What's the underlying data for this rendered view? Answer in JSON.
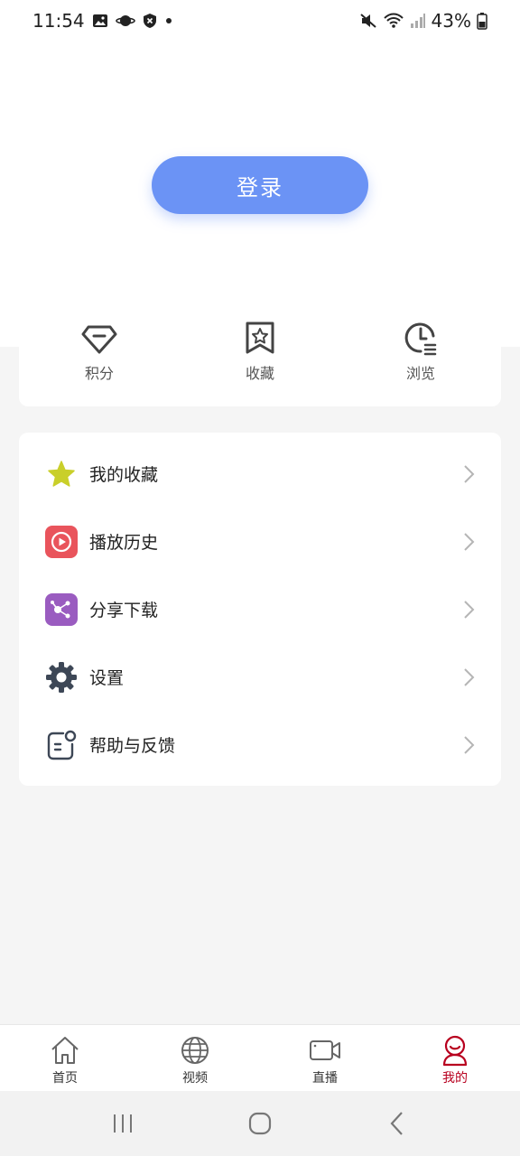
{
  "status_bar": {
    "time": "11:54",
    "battery": "43%"
  },
  "login": {
    "label": "登录"
  },
  "quick_actions": [
    {
      "label": "积分",
      "icon": "diamond-icon"
    },
    {
      "label": "收藏",
      "icon": "bookmark-star-icon"
    },
    {
      "label": "浏览",
      "icon": "history-clock-icon"
    }
  ],
  "menu": [
    {
      "label": "我的收藏",
      "icon": "star-icon"
    },
    {
      "label": "播放历史",
      "icon": "play-history-icon"
    },
    {
      "label": "分享下载",
      "icon": "share-icon"
    },
    {
      "label": "设置",
      "icon": "gear-icon"
    },
    {
      "label": "帮助与反馈",
      "icon": "feedback-icon"
    }
  ],
  "tabs": [
    {
      "label": "首页",
      "icon": "home-icon",
      "active": false
    },
    {
      "label": "视频",
      "icon": "globe-icon",
      "active": false
    },
    {
      "label": "直播",
      "icon": "video-camera-icon",
      "active": false
    },
    {
      "label": "我的",
      "icon": "user-icon",
      "active": true
    }
  ],
  "colors": {
    "accent": "#6b93f5",
    "active_tab": "#b8001f",
    "star": "#c9cf2a",
    "play_history": "#e9545c",
    "share": "#9a5cc0",
    "gear": "#3d4756"
  }
}
